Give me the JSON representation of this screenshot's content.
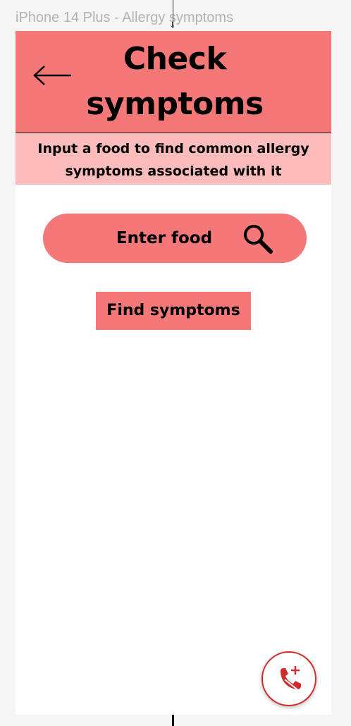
{
  "canvas": {
    "frame_label": "iPhone 14 Plus -  Allergy symptoms"
  },
  "header": {
    "title_line1": "Check",
    "title_line2": "symptoms",
    "back_icon": "arrow-left-icon",
    "background_color": "#f47878"
  },
  "subtitle": {
    "line1": "Input a food to find common allergy",
    "line2": "symptoms associated with it",
    "background_color": "#fdbcbc"
  },
  "search": {
    "placeholder": "Enter food",
    "icon": "search-icon"
  },
  "actions": {
    "find_label": "Find symptoms"
  },
  "fab": {
    "icon": "emergency-call-icon",
    "accent_color": "#cf2b2b"
  }
}
